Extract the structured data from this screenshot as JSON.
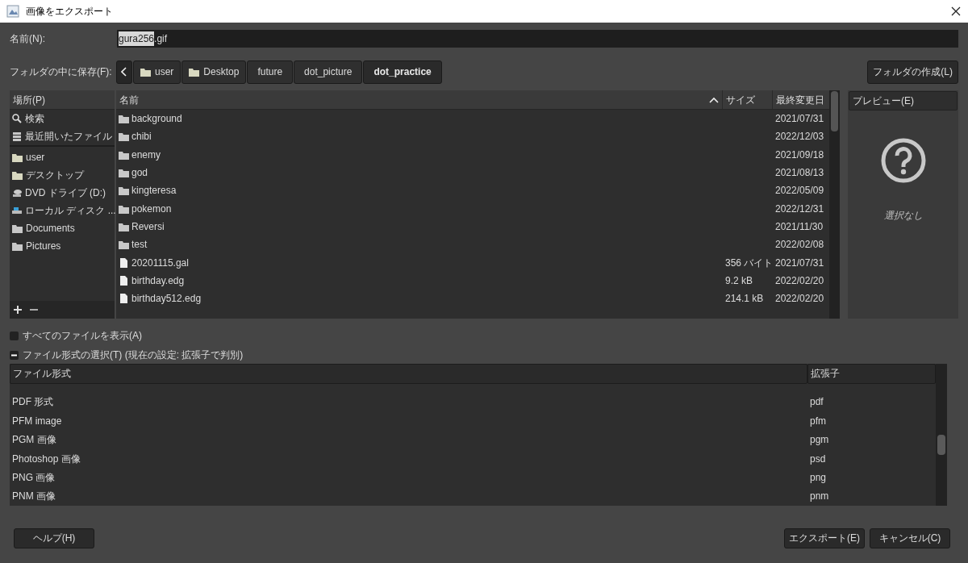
{
  "window": {
    "title": "画像をエクスポート"
  },
  "name_field": {
    "label": "名前(N):",
    "selected_text": "gura256",
    "unselected_text": ".gif"
  },
  "save_in": {
    "label": "フォルダの中に保存(F):",
    "path": [
      {
        "label": "user",
        "kind": "folder",
        "selected": false
      },
      {
        "label": "Desktop",
        "kind": "folder",
        "selected": false
      },
      {
        "label": "future",
        "kind": "plain",
        "selected": false
      },
      {
        "label": "dot_picture",
        "kind": "plain",
        "selected": false
      },
      {
        "label": "dot_practice",
        "kind": "plain",
        "selected": true
      }
    ]
  },
  "create_folder_button": "フォルダの作成(L)",
  "places": {
    "header": "場所(P)",
    "sections": [
      {
        "items": [
          {
            "label": "検索",
            "kind": "search"
          },
          {
            "label": "最近開いたファイル",
            "kind": "recent"
          }
        ]
      },
      {
        "items": [
          {
            "label": "user",
            "kind": "folder"
          },
          {
            "label": "デスクトップ",
            "kind": "folder"
          },
          {
            "label": "DVD ドライブ (D:)",
            "kind": "dvd"
          },
          {
            "label": "ローカル ディスク ...",
            "kind": "disk"
          },
          {
            "label": "Documents",
            "kind": "gray-folder"
          },
          {
            "label": "Pictures",
            "kind": "gray-folder"
          }
        ]
      }
    ]
  },
  "files": {
    "columns": [
      "名前",
      "サイズ",
      "最終変更日"
    ],
    "sort_ascending": true,
    "rows": [
      {
        "name": "background",
        "kind": "folder",
        "modified": "2021/07/31"
      },
      {
        "name": "chibi",
        "kind": "folder",
        "modified": "2022/12/03"
      },
      {
        "name": "enemy",
        "kind": "folder",
        "modified": "2021/09/18"
      },
      {
        "name": "god",
        "kind": "folder",
        "modified": "2021/08/13"
      },
      {
        "name": "kingteresa",
        "kind": "folder",
        "modified": "2022/05/09"
      },
      {
        "name": "pokemon",
        "kind": "folder",
        "modified": "2022/12/31"
      },
      {
        "name": "Reversi",
        "kind": "folder",
        "modified": "2021/11/30"
      },
      {
        "name": "test",
        "kind": "folder",
        "modified": "2022/02/08"
      },
      {
        "name": "20201115.gal",
        "kind": "file",
        "size": "356 バイト",
        "modified": "2021/07/31"
      },
      {
        "name": "birthday.edg",
        "kind": "file",
        "size": "9.2 kB",
        "modified": "2022/02/20"
      },
      {
        "name": "birthday512.edg",
        "kind": "file",
        "size": "214.1 kB",
        "modified": "2022/02/20"
      }
    ]
  },
  "preview": {
    "header": "プレビュー(E)",
    "message": "選択なし"
  },
  "show_all_files": {
    "label": "すべてのファイルを表示(A)",
    "checked": false
  },
  "file_type": {
    "label": "ファイル形式の選択(T) (現在の設定: 拡張子で判別)",
    "expanded": true,
    "columns": [
      "ファイル形式",
      "拡張子"
    ],
    "rows": [
      {
        "format": "PDF 形式",
        "extension": "pdf"
      },
      {
        "format": "PFM image",
        "extension": "pfm"
      },
      {
        "format": "PGM 画像",
        "extension": "pgm"
      },
      {
        "format": "Photoshop 画像",
        "extension": "psd"
      },
      {
        "format": "PNG 画像",
        "extension": "png"
      },
      {
        "format": "PNM 画像",
        "extension": "pnm"
      }
    ]
  },
  "buttons": {
    "help": "ヘルプ(H)",
    "export": "エクスポート(E)",
    "cancel": "キャンセル(C)"
  }
}
